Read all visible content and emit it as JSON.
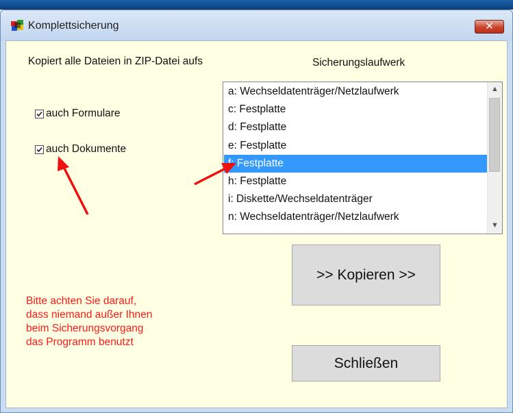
{
  "window": {
    "title": "Komplettsicherung",
    "close_symbol": "✕"
  },
  "labels": {
    "copy_all": "Kopiert alle Dateien  in ZIP-Datei aufs",
    "backup_drive": "Sicherungslaufwerk"
  },
  "options": [
    {
      "label": "auch Formulare",
      "checked": true
    },
    {
      "label": "auch Dokumente",
      "checked": true
    }
  ],
  "drive_list": {
    "items": [
      "a:  Wechseldatenträger/Netzlaufwerk",
      "c:  Festplatte",
      "d:  Festplatte",
      "e:  Festplatte",
      "f:  Festplatte",
      "h:  Festplatte",
      "i:  Diskette/Wechseldatenträger",
      "n:  Wechseldatenträger/Netzlaufwerk"
    ],
    "selected_index": 4
  },
  "buttons": {
    "copy": ">> Kopieren >>",
    "close": "Schließen"
  },
  "warning": "Bitte achten Sie darauf,\ndass niemand außer Ihnen\nbeim Sicherungsvorgang\ndas Programm benutzt",
  "colors": {
    "client_bg": "#ffffe3",
    "selection": "#3399ff",
    "warning_text": "#ff1a1a",
    "annotation_arrow": "#ee1111"
  },
  "icons": [
    "app-icon",
    "close-icon",
    "check-icon",
    "scroll-up-icon",
    "scroll-down-icon"
  ]
}
